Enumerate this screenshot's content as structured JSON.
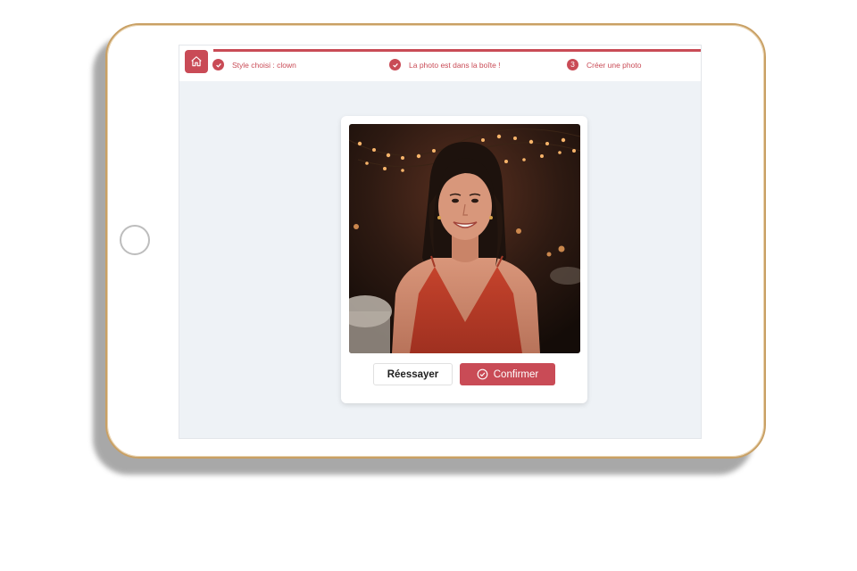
{
  "steps": [
    {
      "label": "Style choisi : clown",
      "state": "done"
    },
    {
      "label": "La photo est dans la boîte !",
      "state": "done"
    },
    {
      "label": "Créer une photo",
      "number": "3",
      "state": "current"
    }
  ],
  "actions": {
    "retry_label": "Réessayer",
    "confirm_label": "Confirmer"
  },
  "colors": {
    "accent": "#c94b56",
    "screen_background": "#eef2f6",
    "tablet_frame": "#c9a064"
  },
  "icons": {
    "home": "home-icon",
    "step_done": "check-icon",
    "confirm": "check-circle-icon"
  }
}
